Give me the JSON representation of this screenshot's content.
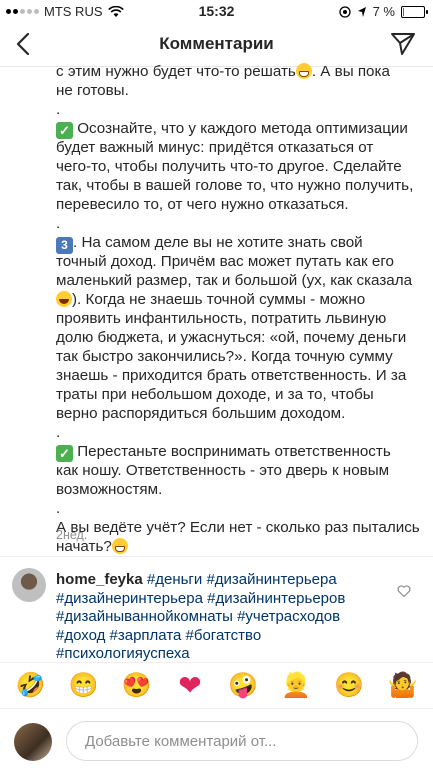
{
  "status_bar": {
    "carrier": "MTS RUS",
    "time": "15:32",
    "battery_text": "7 %",
    "battery_level": 0.07,
    "battery_color": "#e53935"
  },
  "nav": {
    "title": "Комментарии",
    "back_icon": "chevron-left-icon",
    "send_icon": "paper-plane-icon"
  },
  "caption": {
    "line1": "с этим нужно будет что-то решать",
    "line1_tail": ". А вы пока",
    "line2": "не готовы.",
    "sep1": ".",
    "line4": " Осознайте, что у каждого метода оптимизации",
    "line5": "будет важный минус: придётся отказаться от",
    "line6": "чего-то, чтобы получить что-то другое. Сделайте",
    "line7": "так, чтобы в вашей голове то, что нужно получить,",
    "line8": "перевесило то, от чего нужно отказаться.",
    "sep2": ".",
    "line10": ". На самом деле вы не хотите знать свой",
    "line11": "точный доход. Причём вас может путать как его",
    "line12": "маленький размер, так и большой (ух, как сказала",
    "line13": "). Когда не знаешь точной суммы - можно",
    "line14": "проявить инфантильность, потратить львиную",
    "line15": "долю бюджета, и ужаснуться: «ой, почему деньги",
    "line16": "так быстро закончились?». Когда точную сумму",
    "line17": "знаешь - приходится брать ответственность. И за",
    "line18": "траты при небольшом доходе, и за то, чтобы",
    "line19": "верно распорядиться большим доходом.",
    "sep3": ".",
    "line21": " Перестаньте воспринимать ответственность",
    "line22": "как ношу. Ответственность - это дверь к новым",
    "line23": "возможностям.",
    "sep4": ".",
    "line25": "А вы ведёте учёт? Если нет - сколько раз пытались",
    "line26": "начать?",
    "timestamp": "2нед."
  },
  "comment": {
    "username": "home_feyka",
    "line1_tag": "#деньги #дизайнинтерьера",
    "line2": "#дизайнеринтерьера #дизайнинтерьеров",
    "line3": "#дизайнываннойкомнаты #учетрасходов",
    "line4": "#доход #зарплата #богатство",
    "line5": "#психологияуспеха"
  },
  "emoji_bar": [
    {
      "name": "rofl-emoji",
      "glyph": "🤣"
    },
    {
      "name": "grinning-emoji",
      "glyph": "😁"
    },
    {
      "name": "heart-eyes-emoji",
      "glyph": "😍"
    },
    {
      "name": "red-heart-emoji",
      "glyph": "❤"
    },
    {
      "name": "zany-face-emoji",
      "glyph": "🤪"
    },
    {
      "name": "woman-blonde-emoji",
      "glyph": "👱"
    },
    {
      "name": "smile-emoji",
      "glyph": "😊"
    },
    {
      "name": "woman-shrugging-emoji",
      "glyph": "🤷"
    }
  ],
  "input": {
    "placeholder": "Добавьте комментарий от..."
  }
}
